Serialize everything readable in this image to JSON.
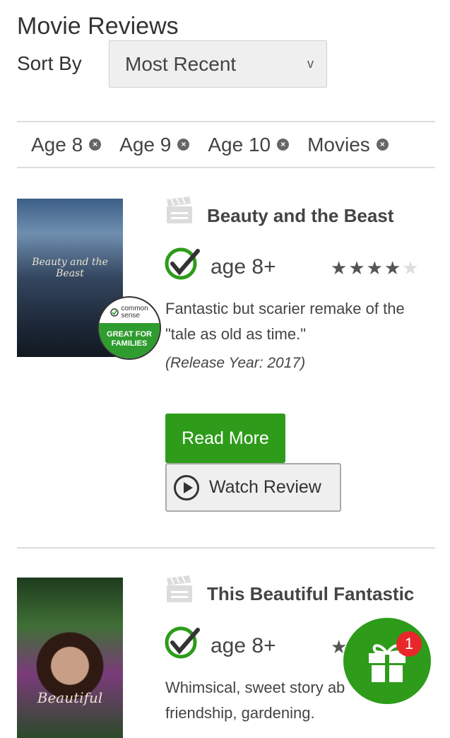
{
  "page": {
    "title": "Movie Reviews"
  },
  "sort": {
    "label": "Sort By",
    "selected": "Most Recent",
    "chevron": "v"
  },
  "filters": [
    {
      "label": "Age 8"
    },
    {
      "label": "Age 9"
    },
    {
      "label": "Age 10"
    },
    {
      "label": "Movies"
    }
  ],
  "reviews": [
    {
      "title": "Beauty and the Beast",
      "age": "age 8+",
      "rating": 4,
      "rating_max": 5,
      "description": "Fantastic but scarier remake of the \"tale as old as time.\"",
      "release": "(Release Year: 2017)",
      "read_more": "Read More",
      "watch_review": "Watch Review",
      "poster_title": "Beauty and the Beast",
      "badge": {
        "brand_line1": "common",
        "brand_line2": "sense",
        "label_line1": "GREAT FOR",
        "label_line2": "FAMILIES"
      }
    },
    {
      "title": "This Beautiful Fantastic",
      "age": "age 8+",
      "description_line1": "Whimsical, sweet story ab",
      "description_line2": "friendship, gardening.",
      "poster_title": "Beautiful"
    }
  ],
  "gift": {
    "count": "1",
    "icon": "gift-icon"
  },
  "colors": {
    "accent_green": "#2e9c1a",
    "badge_red": "#e8272a"
  }
}
